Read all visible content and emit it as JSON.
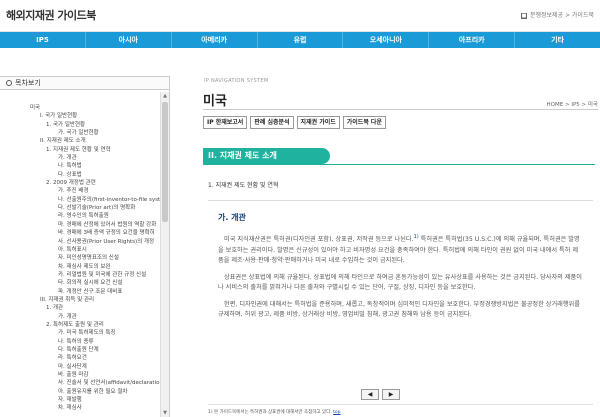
{
  "header": {
    "logo": "해외지재권 가이드북",
    "breadcrumb": "분쟁정보제공 > 가이드북",
    "crumb_icon": "home-icon"
  },
  "nav": [
    "IP5",
    "아시아",
    "아메리카",
    "유럽",
    "오세아니아",
    "아프리카",
    "기타"
  ],
  "sidebar": {
    "heading": "목차보기",
    "tree": [
      {
        "label": "미국",
        "level": 0
      },
      {
        "label": "I. 국가 일반현황",
        "level": 1
      },
      {
        "label": "1. 국가 일반현황",
        "level": 2
      },
      {
        "label": "가. 국가 일반현황",
        "level": 3
      },
      {
        "label": "II. 지재권 제도 소개",
        "level": 1
      },
      {
        "label": "1. 지재권 제도 현황 및 연혁",
        "level": 2
      },
      {
        "label": "가. 개관",
        "level": 3
      },
      {
        "label": "나. 특허법",
        "level": 3
      },
      {
        "label": "다. 상표법",
        "level": 3
      },
      {
        "label": "2. 2009 개정법 관련",
        "level": 2
      },
      {
        "label": "가. 추진 배경",
        "level": 3
      },
      {
        "label": "나. 선출원주의(first-inventor-to-file system)",
        "level": 3
      },
      {
        "label": "다. 선발기술(Prior art)의 명확화",
        "level": 3
      },
      {
        "label": "라. 영수인의 특허출원",
        "level": 3
      },
      {
        "label": "마. 경매에 산정에 있어서 법원의 역할 강화",
        "level": 3
      },
      {
        "label": "바. 경매에 3배 증액 규정의 요건을 명확히",
        "level": 3
      },
      {
        "label": "사. 선사용권(Prior User Rights)의 개정",
        "level": 3
      },
      {
        "label": "아. 특허표시",
        "level": 3
      },
      {
        "label": "자. 미인성명명표조의 신설",
        "level": 3
      },
      {
        "label": "차. 재심사 제도의 보완",
        "level": 3
      },
      {
        "label": "카. 리얼법원 및 미국에 관한 규정 신설",
        "level": 3
      },
      {
        "label": "타. 회의적 실시에 요건 신설",
        "level": 3
      },
      {
        "label": "파. 개정안 신구 조문 대비표",
        "level": 3
      },
      {
        "label": "III. 지재권 취득 및 관리",
        "level": 1
      },
      {
        "label": "1. 개관",
        "level": 2
      },
      {
        "label": "가. 개관",
        "level": 3
      },
      {
        "label": "2. 특허제도 출원 및 관리",
        "level": 2
      },
      {
        "label": "가. 미국 특허제도의 특징",
        "level": 3
      },
      {
        "label": "나. 특허의 종류",
        "level": 3
      },
      {
        "label": "다. 특허출원 단계",
        "level": 3
      },
      {
        "label": "라. 특허요건",
        "level": 3
      },
      {
        "label": "마. 실사단계",
        "level": 3
      },
      {
        "label": "바. 출원 마감",
        "level": 3
      },
      {
        "label": "사. 진술서 및 선언서(affidavit/declaration)",
        "level": 3
      },
      {
        "label": "아. 출원유지를 위한 필요 절차",
        "level": 3
      },
      {
        "label": "자. 재발행",
        "level": 3
      },
      {
        "label": "차. 재심사",
        "level": 3
      }
    ]
  },
  "main": {
    "system_label": "IP NAVIGATION SYSTEM",
    "title": "미국",
    "breadcrumb": "HOME > IP5 > 미국",
    "tabs": [
      "IP 한재보고서",
      "판례 심층분석",
      "지재권 가이드",
      "가이드북 다운"
    ],
    "section": "II. 지재권 제도 소개",
    "sub_heading": "1. 지재권 제도 현황 및 연혁",
    "content_title": "가. 개관",
    "para1": "미국 지식재산권은 특허권(디자인권 포함), 상표권, 저작권 등으로 나뉜다.",
    "para1_sup": "1)",
    "para1b": " 특허권은 특허법(35 U.S.C.)에 의해 규율되며, 특허권은 발명을 보호하는 권리이다. 발명은 신규성이 있어야 하고 비자명성 요건을 충족하여야 한다. 특허법에 의해 타인이 권원 없이 미국 내에서 특허 제품을 제조·사용·판매·청약·판매하거나 미국 내로 수입하는 것이 금지된다.",
    "para2": "상표권은 상표법에 의해 규율된다. 상표법에 의해 타인으로 하여금 혼동가능성이 있는 유사상표를 사용하는 것은 금지된다. 당사자의 제품이나 서비스의 출처를 밝혀거나 다른 출처와 구별시킬 수 있는 단어, 구절, 상징, 디자인 등을 보호한다.",
    "para3": "한편, 디자인권에 대해서는 특허법을 준용하며, 새롭고, 독창적이며 심미적인 디자인을 보호한다. 부정경쟁방지법은 불공정한 상거래행위를 규제하며, 허위 광고, 제품 비방, 상거래상 비방, 영업비밀 침해, 광고권 침해와 남용 등이 금지된다.",
    "pager_prev": "◀",
    "pager_next": "▶",
    "footnote": "1) 본 가이드북에서는 특허권과 상표권에 대해서만 초점하고 있다.",
    "footnote_top": "top"
  },
  "colors": {
    "nav_blue": "#1a9ad6",
    "section_teal": "#1fb29e",
    "heading_navy": "#0a3d7a"
  }
}
